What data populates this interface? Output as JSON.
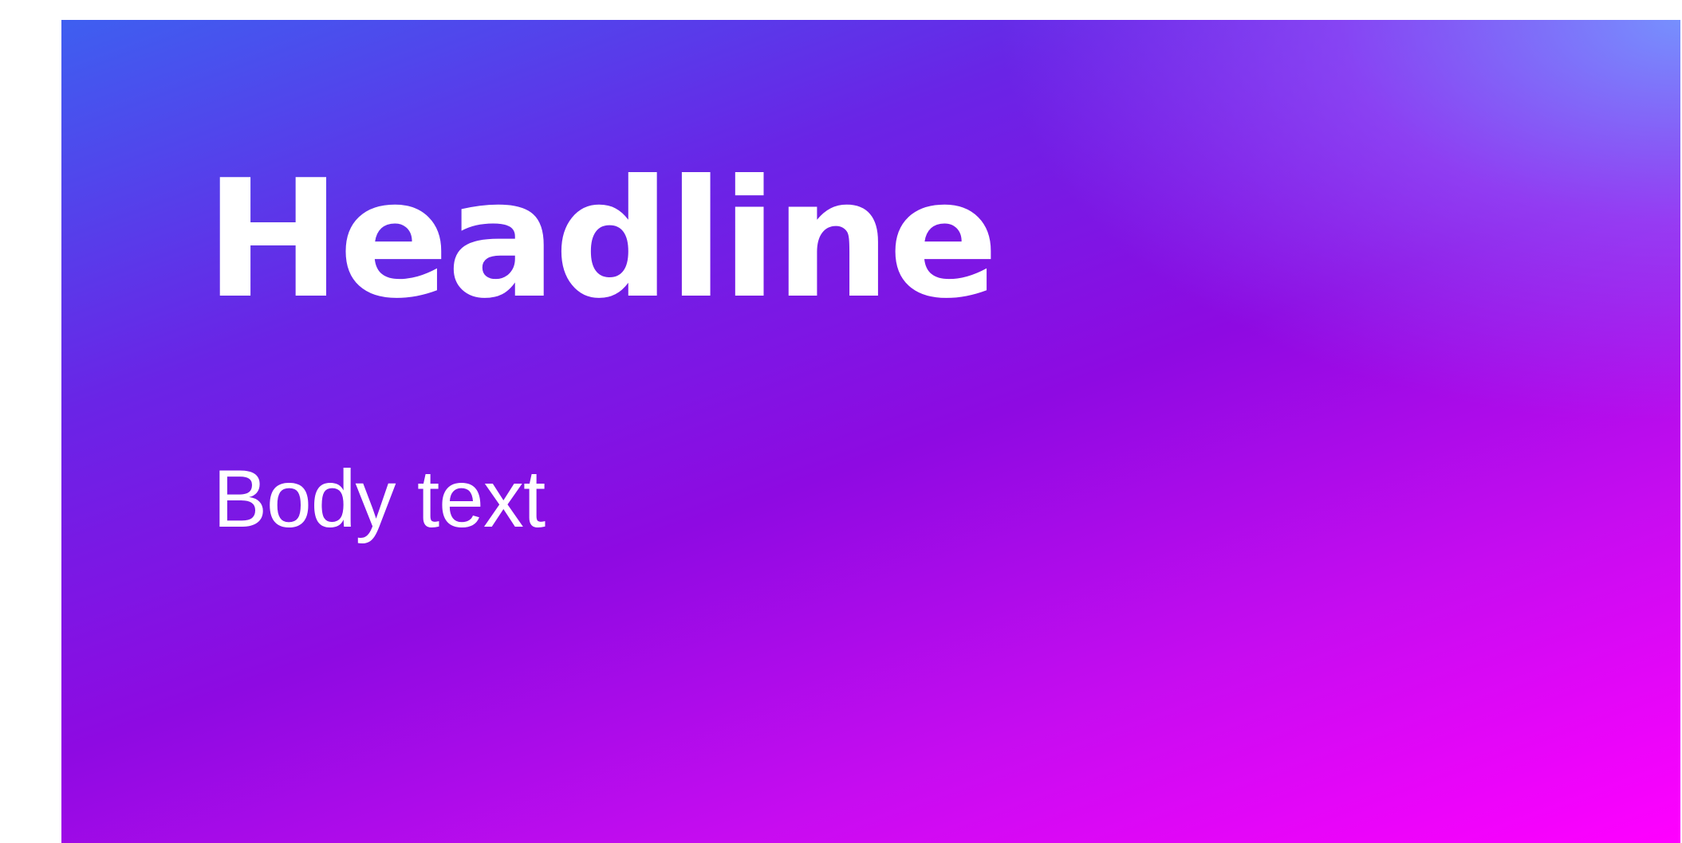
{
  "card": {
    "headline": "Headline",
    "body": "Body text"
  },
  "colors": {
    "gradient_top_left": "#3e5ff0",
    "gradient_top_right": "#7696ff",
    "gradient_mid": "#8e0ae2",
    "gradient_bottom_right": "#ff00ff",
    "text": "#ffffff",
    "page_background": "#ffffff"
  }
}
